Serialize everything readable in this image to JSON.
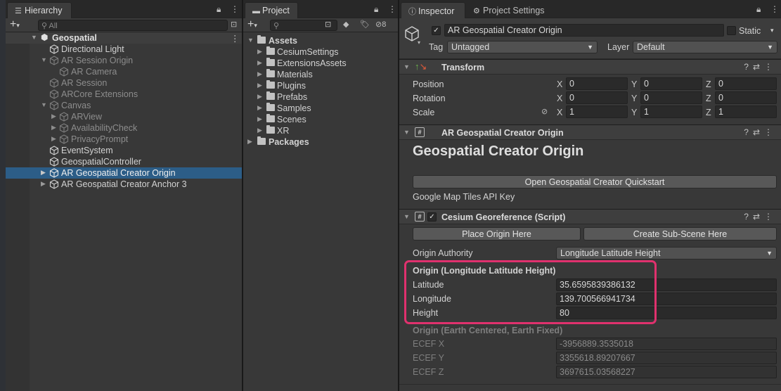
{
  "colors": {
    "selection": "#2c5d87",
    "highlight_box": "#e0316e",
    "panel_bg": "#383838"
  },
  "hierarchy": {
    "tab_label": "Hierarchy",
    "search_placeholder": "All",
    "scene_name": "Geospatial",
    "items": [
      {
        "label": "Directional Light"
      },
      {
        "label": "AR Session Origin"
      },
      {
        "label": "AR Camera"
      },
      {
        "label": "AR Session"
      },
      {
        "label": "ARCore Extensions"
      },
      {
        "label": "Canvas"
      },
      {
        "label": "ARView"
      },
      {
        "label": "AvailabilityCheck"
      },
      {
        "label": "PrivacyPrompt"
      },
      {
        "label": "EventSystem"
      },
      {
        "label": "GeospatialController"
      },
      {
        "label": "AR Geospatial Creator Origin"
      },
      {
        "label": "AR Geospatial Creator Anchor 3"
      }
    ]
  },
  "project": {
    "tab_label": "Project",
    "hidden_count": "8",
    "root": "Assets",
    "folders": [
      "CesiumSettings",
      "ExtensionsAssets",
      "Materials",
      "Plugins",
      "Prefabs",
      "Samples",
      "Scenes",
      "XR"
    ],
    "packages": "Packages"
  },
  "inspector": {
    "tab_label": "Inspector",
    "tab2_label": "Project Settings",
    "object_name": "AR Geospatial Creator Origin",
    "static_label": "Static",
    "tag_label": "Tag",
    "tag_value": "Untagged",
    "layer_label": "Layer",
    "layer_value": "Default",
    "transform": {
      "title": "Transform",
      "position_label": "Position",
      "rotation_label": "Rotation",
      "scale_label": "Scale",
      "x": "X",
      "y": "Y",
      "z": "Z",
      "position": [
        "0",
        "0",
        "0"
      ],
      "rotation": [
        "0",
        "0",
        "0"
      ],
      "scale": [
        "1",
        "1",
        "1"
      ]
    },
    "origin_component": {
      "title": "AR Geospatial Creator Origin",
      "heading": "Geospatial Creator Origin",
      "quickstart_button": "Open Geospatial Creator Quickstart",
      "api_key_label": "Google Map Tiles API Key"
    },
    "cesium": {
      "title": "Cesium Georeference (Script)",
      "place_origin_button": "Place Origin Here",
      "create_subscene_button": "Create Sub-Scene Here",
      "authority_label": "Origin Authority",
      "authority_value": "Longitude Latitude Height",
      "llh_heading": "Origin (Longitude Latitude Height)",
      "latitude_label": "Latitude",
      "latitude_value": "35.6595839386132",
      "longitude_label": "Longitude",
      "longitude_value": "139.700566941734",
      "height_label": "Height",
      "height_value": "80",
      "ecef_heading": "Origin (Earth Centered, Earth Fixed)",
      "ecef_x_label": "ECEF X",
      "ecef_x_value": "-3956889.3535018",
      "ecef_y_label": "ECEF Y",
      "ecef_y_value": "3355618.89207667",
      "ecef_z_label": "ECEF Z",
      "ecef_z_value": "3697615.03568227"
    }
  }
}
